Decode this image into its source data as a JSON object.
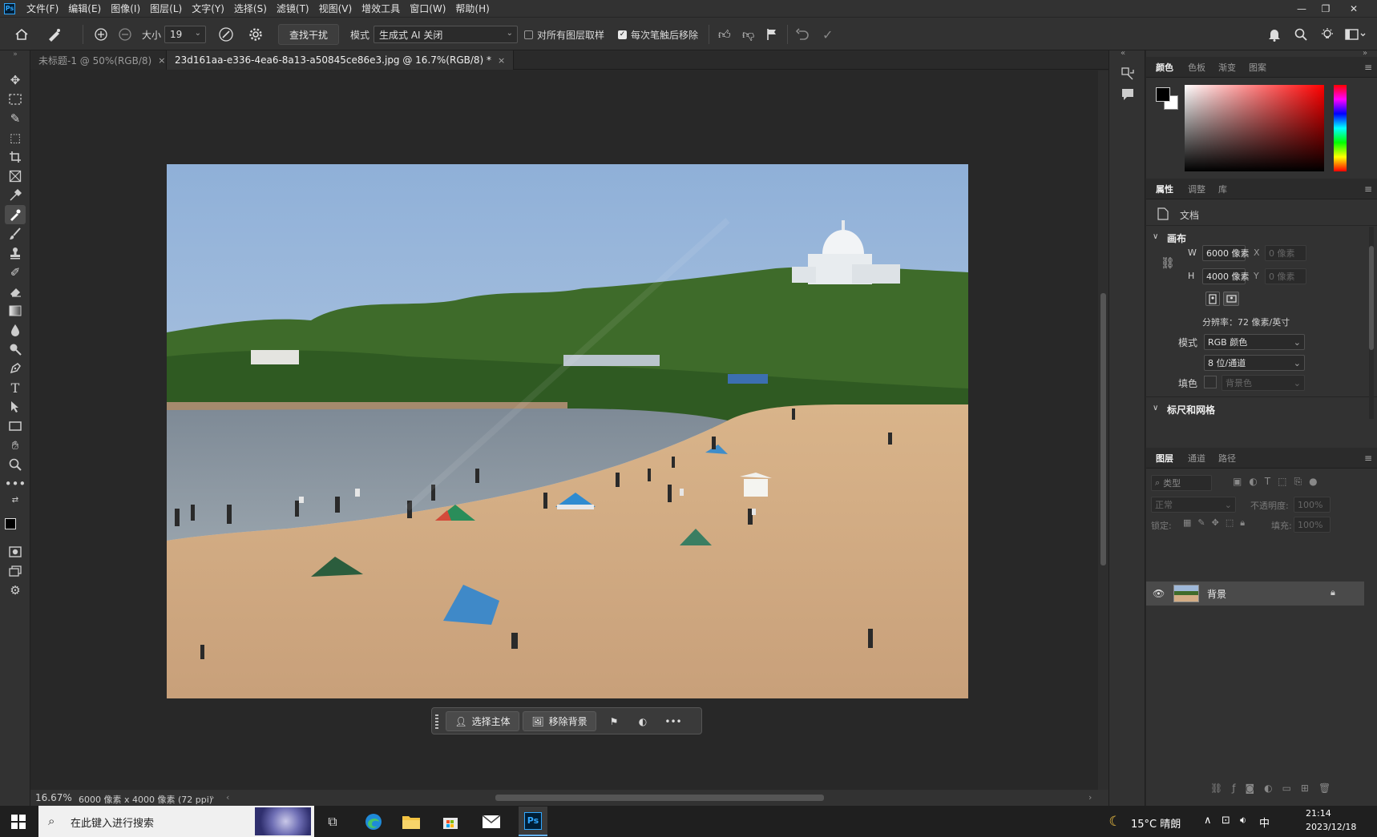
{
  "app": {
    "logo": "Ps"
  },
  "menu": [
    "文件(F)",
    "编辑(E)",
    "图像(I)",
    "图层(L)",
    "文字(Y)",
    "选择(S)",
    "滤镜(T)",
    "视图(V)",
    "增效工具",
    "窗口(W)",
    "帮助(H)"
  ],
  "options": {
    "size_label": "大小",
    "size_value": "19",
    "find_distraction": "查找干扰",
    "mode_label": "模式",
    "mode_value": "生成式 AI 关闭",
    "sample_all": "对所有图层取样",
    "sample_all_checked": false,
    "remove_after": "每次笔触后移除",
    "remove_after_checked": true
  },
  "tabs": [
    {
      "label": "未标题-1 @ 50%(RGB/8)",
      "active": false
    },
    {
      "label": "23d161aa-e336-4ea6-8a13-a50845ce86e3.jpg @ 16.7%(RGB/8) *",
      "active": true
    }
  ],
  "context_bar": {
    "select_subject": "选择主体",
    "remove_background": "移除背景"
  },
  "status": {
    "zoom": "16.67%",
    "doc_info": "6000 像素 x 4000 像素 (72 ppi)"
  },
  "color_panel": {
    "tabs": [
      "颜色",
      "色板",
      "渐变",
      "图案"
    ],
    "fg_color": "#000000",
    "bg_color": "#ffffff",
    "picker_hue": "#ff0000"
  },
  "properties": {
    "tabs": [
      "属性",
      "调整",
      "库"
    ],
    "doc_label": "文档",
    "canvas_header": "画布",
    "w_label": "W",
    "w_value": "6000 像素",
    "h_label": "H",
    "h_value": "4000 像素",
    "x_label": "X",
    "x_value": "0 像素",
    "y_label": "Y",
    "y_value": "0 像素",
    "resolution": "分辨率：72 像素/英寸",
    "mode_label": "模式",
    "mode_value": "RGB 颜色",
    "depth_value": "8 位/通道",
    "fill_label": "填色",
    "fill_value": "背景色",
    "rulers_header": "标尺和网格"
  },
  "layers": {
    "tabs": [
      "图层",
      "通道",
      "路径"
    ],
    "filter_placeholder": "类型",
    "blend_mode": "正常",
    "opacity_label": "不透明度:",
    "opacity_value": "100%",
    "lock_label": "锁定:",
    "fill_label": "填充:",
    "fill_value": "100%",
    "items": [
      {
        "name": "背景",
        "visible": true,
        "locked": true
      }
    ]
  },
  "taskbar": {
    "search_placeholder": "在此键入进行搜索",
    "weather": "15°C  晴朗",
    "time": "21:14",
    "date": "2023/12/18",
    "ime": "中"
  }
}
